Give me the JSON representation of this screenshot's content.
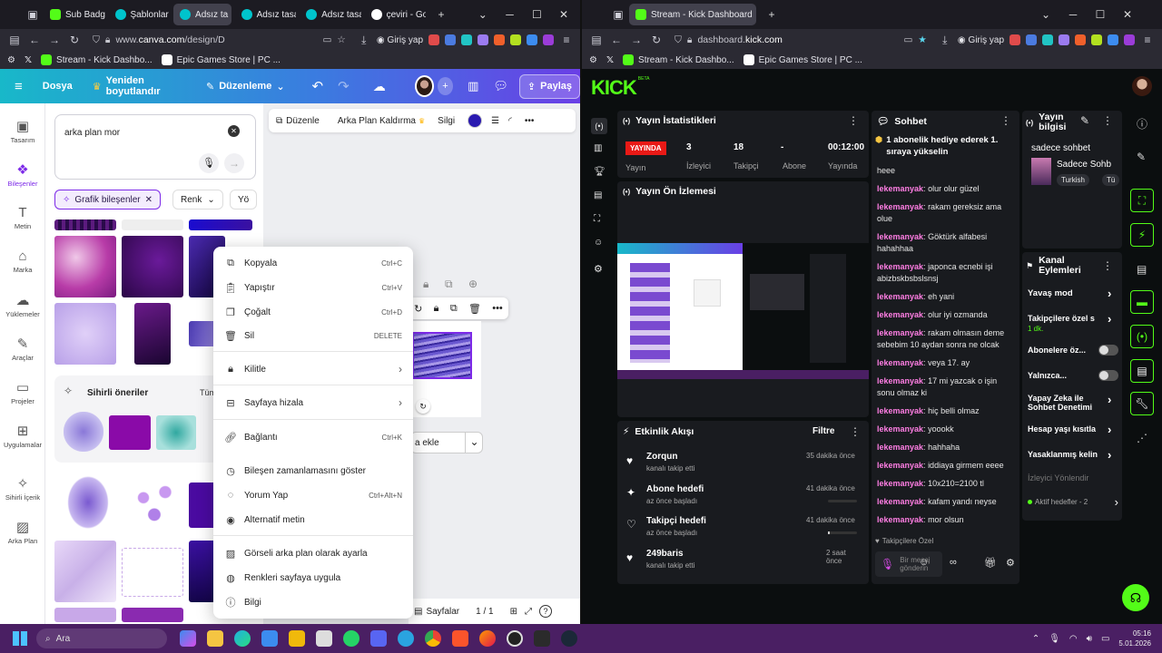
{
  "left_browser": {
    "tabs": [
      {
        "label": "Sub Badge",
        "color": "#53fc18"
      },
      {
        "label": "Şablonlar",
        "color": "#00c4cc"
      },
      {
        "label": "Adsız ta",
        "color": "#00c4cc"
      },
      {
        "label": "Adsız tasar",
        "color": "#00c4cc"
      },
      {
        "label": "Adsız tasar",
        "color": "#00c4cc"
      },
      {
        "label": "çeviri - Go",
        "color": "#ffffff"
      }
    ],
    "url_dim": "www.",
    "url_host": "canva.com",
    "url_path": "/design/D",
    "signin": "Giriş yap",
    "bookmarks": [
      "Stream - Kick Dashbo...",
      "Epic Games Store | PC ..."
    ]
  },
  "canva": {
    "file_label": "Dosya",
    "resize_label": "Yeniden boyutlandır",
    "edit_label": "Düzenleme",
    "share_label": "Paylaş",
    "rail": [
      "Tasarım",
      "Bileşenler",
      "Metin",
      "Marka",
      "Yüklemeler",
      "Araçlar",
      "Projeler",
      "Uygulamalar",
      "Sihirli İçerik",
      "Arka Plan"
    ],
    "search_value": "arka plan mor",
    "filter_chip": "Grafik bileşenler",
    "filter_color": "Renk",
    "filter_more": "Yö",
    "magic_title": "Sihirli öneriler",
    "magic_more": "Tüm",
    "toolbar": {
      "edit": "Düzenle",
      "bg_remove": "Arka Plan Kaldırma",
      "erase": "Silgi"
    },
    "page_add": "a ekle",
    "pages_label": "Sayfalar",
    "page_count": "1 / 1"
  },
  "context_menu": [
    {
      "label": "Kopyala",
      "shortcut": "Ctrl+C",
      "icon": "copy-icon"
    },
    {
      "label": "Yapıştır",
      "shortcut": "Ctrl+V",
      "icon": "paste-icon"
    },
    {
      "label": "Çoğalt",
      "shortcut": "Ctrl+D",
      "icon": "duplicate-icon"
    },
    {
      "label": "Sil",
      "shortcut": "DELETE",
      "icon": "trash-icon"
    },
    {
      "label": "Kilitle",
      "shortcut": "",
      "icon": "lock-icon"
    },
    {
      "label": "Sayfaya hizala",
      "shortcut": "",
      "icon": "align-icon"
    },
    {
      "label": "Bağlantı",
      "shortcut": "Ctrl+K",
      "icon": "link-icon"
    },
    {
      "label": "Bileşen zamanlamasını göster",
      "shortcut": "",
      "icon": "clock-icon"
    },
    {
      "label": "Yorum Yap",
      "shortcut": "Ctrl+Alt+N",
      "icon": "comment-icon"
    },
    {
      "label": "Alternatif metin",
      "shortcut": "",
      "icon": "alt-text-icon"
    },
    {
      "label": "Görseli arka plan olarak ayarla",
      "shortcut": "",
      "icon": "background-icon"
    },
    {
      "label": "Renkleri sayfaya uygula",
      "shortcut": "",
      "icon": "palette-icon"
    },
    {
      "label": "Bilgi",
      "shortcut": "",
      "icon": "info-icon"
    }
  ],
  "right_browser": {
    "tab": "Stream - Kick Dashboard",
    "url_host": "dashboard.",
    "url_bold": "kick.com",
    "signin": "Giriş yap",
    "bookmarks": [
      "Stream - Kick Dashbo...",
      "Epic Games Store | PC ..."
    ]
  },
  "kick": {
    "logo": "KICK",
    "logo_badge": "BETA",
    "stats": {
      "title": "Yayın İstatistikleri",
      "live_badge": "YAYINDA",
      "viewers": "3",
      "followers": "18",
      "subs": "-",
      "duration": "00:12:00",
      "labels": [
        "Yayın",
        "İzleyici",
        "Takipçi",
        "Abone",
        "Yayında"
      ]
    },
    "preview_title": "Yayın Ön İzlemesi",
    "activity": {
      "title": "Etkinlik Akışı",
      "filter": "Filtre",
      "items": [
        {
          "title": "Zorqun",
          "sub": "kanalı takip etti",
          "time": "35 dakika önce",
          "icon": "heart-icon",
          "progress": null
        },
        {
          "title": "Abone hedefi",
          "sub": "az önce başladı",
          "time": "41 dakika önce",
          "icon": "sparkle-icon",
          "progress": 0.0
        },
        {
          "title": "Takipçi hedefi",
          "sub": "az önce başladı",
          "time": "41 dakika önce",
          "icon": "heart-outline-icon",
          "progress": 0.05
        },
        {
          "title": "249baris",
          "sub": "kanalı takip etti",
          "time": "2 saat önce",
          "icon": "heart-icon",
          "progress": null
        }
      ]
    },
    "chat": {
      "title": "Sohbet",
      "pinned": "1 abonelik hediye ederek 1. sıraya yükselin",
      "messages": [
        {
          "user": "",
          "text": "heee"
        },
        {
          "user": "lekemanyak",
          "text": "olur olur güzel"
        },
        {
          "user": "lekemanyak",
          "text": "rakam gereksiz ama olue"
        },
        {
          "user": "lekemanyak",
          "text": "Göktürk alfabesi hahahhaa"
        },
        {
          "user": "lekemanyak",
          "text": "japonca ecnebi işi abizbskbsbslsnsj"
        },
        {
          "user": "lekemanyak",
          "text": "eh yani"
        },
        {
          "user": "lekemanyak",
          "text": "olur iyi ozmanda"
        },
        {
          "user": "lekemanyak",
          "text": "rakam olmasın deme sebebim 10 aydan sonra ne olcak"
        },
        {
          "user": "lekemanyak",
          "text": "veya 17. ay"
        },
        {
          "user": "lekemanyak",
          "text": "17 mi yazcak o işin sonu olmaz ki"
        },
        {
          "user": "lekemanyak",
          "text": "hiç belli olmaz"
        },
        {
          "user": "lekemanyak",
          "text": "yoookk"
        },
        {
          "user": "lekemanyak",
          "text": "hahhaha"
        },
        {
          "user": "lekemanyak",
          "text": "iddiaya girmem eeee"
        },
        {
          "user": "lekemanyak",
          "text": "10x210=2100 tl"
        },
        {
          "user": "lekemanyak",
          "text": "kafam yandı neyse"
        },
        {
          "user": "lekemanyak",
          "text": "mor olsun"
        }
      ],
      "followers_only": "Takipçilere Özel",
      "input_placeholder": "Bir mesaj gönderin"
    },
    "info": {
      "title": "Yayın bilgisi",
      "stream_title": "sadece sohbet",
      "category": "Sadece Sohb",
      "tag1": "Turkish",
      "tag2": "Tü"
    },
    "actions": {
      "title": "Kanal Eylemleri",
      "items": [
        {
          "label": "Yavaş mod",
          "type": "arrow",
          "sub": ""
        },
        {
          "label": "Takipçilere özel s",
          "type": "arrow",
          "sub": "1 dk."
        },
        {
          "label": "Abonelere öz...",
          "type": "toggle",
          "sub": ""
        },
        {
          "label": "Yalnızca...",
          "type": "toggle",
          "sub": ""
        },
        {
          "label": "Yapay Zeka ile Sohbet Denetimi",
          "type": "arrow",
          "sub": ""
        },
        {
          "label": "Hesap yaşı kısıtla",
          "type": "arrow",
          "sub": ""
        },
        {
          "label": "Yasaklanmış kelin",
          "type": "arrow",
          "sub": ""
        },
        {
          "label": "İzleyici Yönlendir",
          "type": "none",
          "sub": ""
        },
        {
          "label": "Aktif hedefler - 2",
          "type": "arrow",
          "sub": ""
        }
      ]
    }
  },
  "taskbar": {
    "search": "Ara",
    "time": "05:16",
    "date": "5.01.2026"
  },
  "colors": {
    "kick_green": "#53fc18",
    "chat_user": "#ff7ee4",
    "live_red": "#e91916",
    "canva_accent": "#7d2ae8"
  }
}
